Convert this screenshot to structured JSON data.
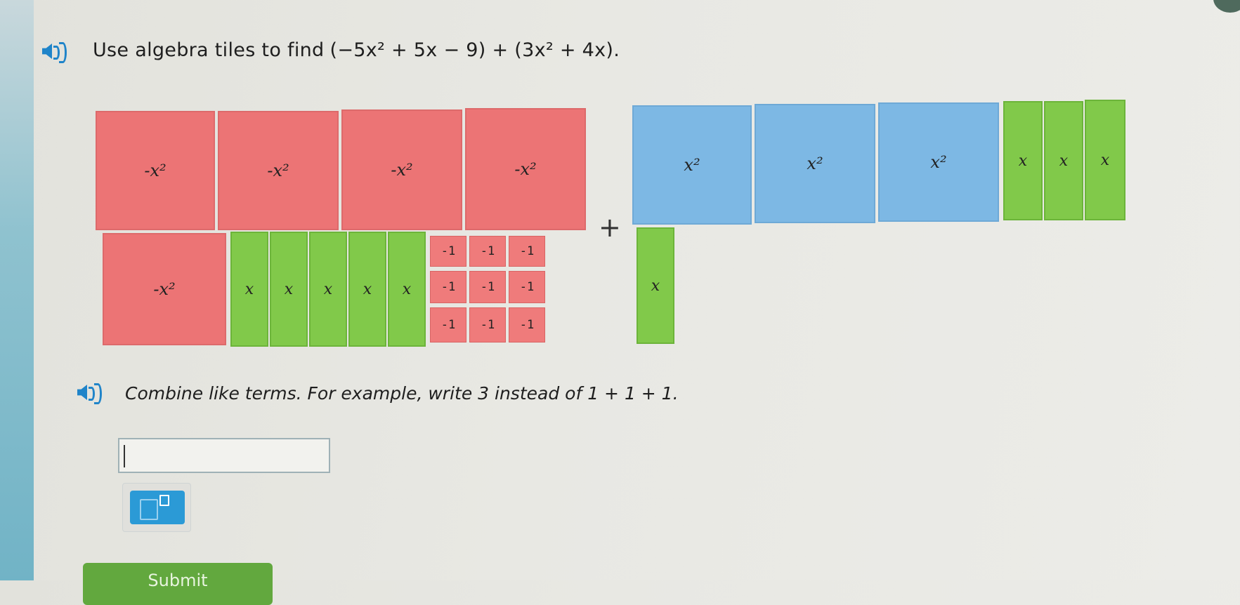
{
  "question": {
    "prompt": "Use algebra tiles to find",
    "expression": "(−5x² + 5x − 9) + (3x² + 4x)."
  },
  "tiles": {
    "neg_x2_label": "-x²",
    "pos_x2_label": "x²",
    "x_label": "x",
    "neg_one_label": "-1",
    "plus_sign": "+"
  },
  "instruction": "Combine like terms. For example, write 3 instead of 1 + 1 + 1.",
  "answer": {
    "value": ""
  },
  "submit": {
    "label": "Submit"
  },
  "colors": {
    "negative_tile": "#ec7475",
    "positive_x2_tile": "#7db8e4",
    "x_tile": "#81c94a",
    "accent": "#1f84c9"
  }
}
